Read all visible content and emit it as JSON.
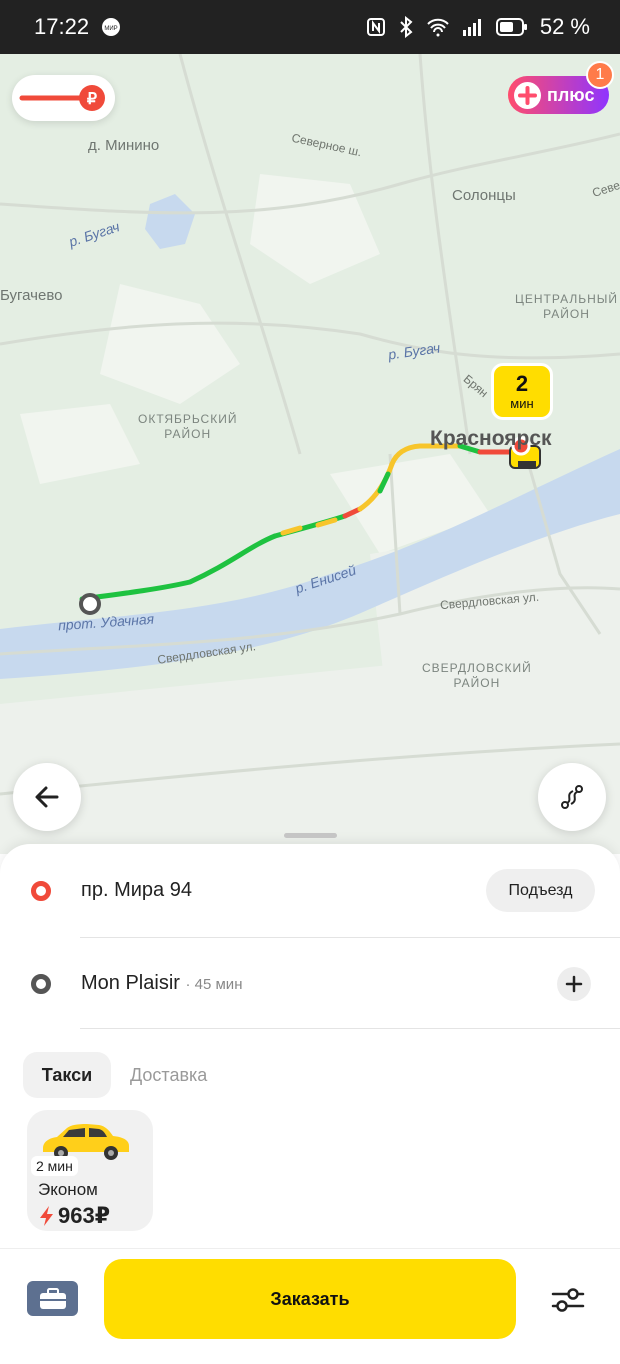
{
  "status_bar": {
    "time": "17:22",
    "mir_badge": "МИР",
    "battery_percent": "52 %"
  },
  "map": {
    "labels": {
      "minino": "д. Минино",
      "severnoe": "Северное ш.",
      "solontsy": "Солонцы",
      "sever_cut": "Севе",
      "bugach_river_1": "р. Бугач",
      "bugachevo": "Бугачево",
      "central_district": "ЦЕНТРАЛЬНЫЙ\nРАЙОН",
      "bugach_river_2": "р. Бугач",
      "bryan": "Брян",
      "oktyabrsky_district": "ОКТЯБРЬСКИЙ\nРАЙОН",
      "city": "Красноярск",
      "yenisei": "р. Енисей",
      "sverdlovskaya_1": "Свердловская ул.",
      "udachnaya": "прот. Удачная",
      "sverdlovskaya_2": "Свердловская ул.",
      "sverdlovsky_district": "СВЕРДЛОВСКИЙ\nРАЙОН"
    },
    "eta": {
      "value": "2",
      "unit": "мин"
    },
    "plus_badge": "плюс",
    "notification_count": "1",
    "colors": {
      "route_green": "#1ec240",
      "route_yellow": "#f7c52b",
      "route_red": "#f04a3a",
      "river": "#c7d9ee",
      "accent_yellow": "#ffdd00"
    }
  },
  "route": {
    "from": {
      "address": "пр. Мира 94",
      "entrance_button": "Подъезд"
    },
    "to": {
      "address": "Mon Plaisir",
      "duration": "· 45 мин"
    }
  },
  "tabs": [
    {
      "label": "Такси",
      "active": true
    },
    {
      "label": "Доставка",
      "active": false
    }
  ],
  "tariff": {
    "eta": "2 мин",
    "name": "Эконом",
    "price": "963₽",
    "surge": true
  },
  "bottom_bar": {
    "order_label": "Заказать"
  }
}
